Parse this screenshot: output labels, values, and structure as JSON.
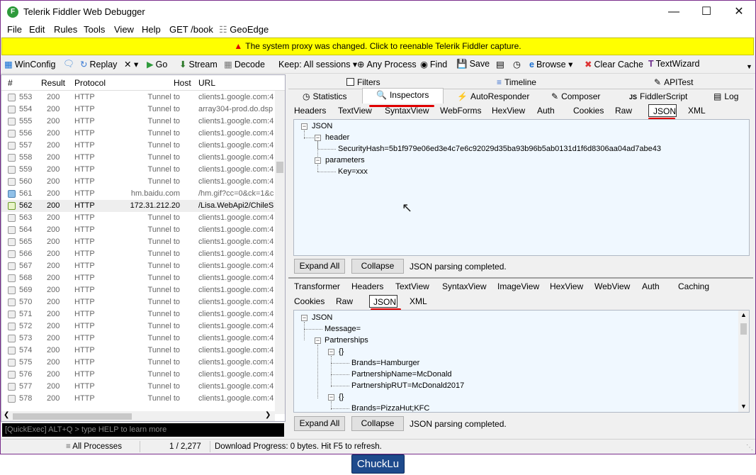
{
  "window": {
    "title": "Telerik Fiddler Web Debugger"
  },
  "menu": [
    "File",
    "Edit",
    "Rules",
    "Tools",
    "View",
    "Help",
    "GET /book",
    "GeoEdge"
  ],
  "notice": "The system proxy was changed. Click to reenable Telerik Fiddler capture.",
  "toolbar": {
    "winconfig": "WinConfig",
    "replay": "Replay",
    "remove": "✕ ▾",
    "go": "Go",
    "stream": "Stream",
    "decode": "Decode",
    "keep": "Keep: All sessions ▾",
    "anyprocess": "Any Process",
    "find": "Find",
    "save": "Save",
    "browse": "Browse",
    "clearcache": "Clear Cache",
    "textwizard": "TextWizard"
  },
  "sessions": {
    "headers": [
      "#",
      "Result",
      "Protocol",
      "Host",
      "URL"
    ],
    "rows": [
      [
        "553",
        "200",
        "HTTP",
        "Tunnel to",
        "clients1.google.com:4"
      ],
      [
        "554",
        "200",
        "HTTP",
        "Tunnel to",
        "array304-prod.do.dsp"
      ],
      [
        "555",
        "200",
        "HTTP",
        "Tunnel to",
        "clients1.google.com:4"
      ],
      [
        "556",
        "200",
        "HTTP",
        "Tunnel to",
        "clients1.google.com:4"
      ],
      [
        "557",
        "200",
        "HTTP",
        "Tunnel to",
        "clients1.google.com:4"
      ],
      [
        "558",
        "200",
        "HTTP",
        "Tunnel to",
        "clients1.google.com:4"
      ],
      [
        "559",
        "200",
        "HTTP",
        "Tunnel to",
        "clients1.google.com:4"
      ],
      [
        "560",
        "200",
        "HTTP",
        "Tunnel to",
        "clients1.google.com:4"
      ],
      [
        "561",
        "200",
        "HTTP",
        "hm.baidu.com",
        "/hm.gif?cc=0&ck=1&c"
      ],
      [
        "562",
        "200",
        "HTTP",
        "172.31.212.20",
        "/Lisa.WebApi2/ChileSe"
      ],
      [
        "563",
        "200",
        "HTTP",
        "Tunnel to",
        "clients1.google.com:4"
      ],
      [
        "564",
        "200",
        "HTTP",
        "Tunnel to",
        "clients1.google.com:4"
      ],
      [
        "565",
        "200",
        "HTTP",
        "Tunnel to",
        "clients1.google.com:4"
      ],
      [
        "566",
        "200",
        "HTTP",
        "Tunnel to",
        "clients1.google.com:4"
      ],
      [
        "567",
        "200",
        "HTTP",
        "Tunnel to",
        "clients1.google.com:4"
      ],
      [
        "568",
        "200",
        "HTTP",
        "Tunnel to",
        "clients1.google.com:4"
      ],
      [
        "569",
        "200",
        "HTTP",
        "Tunnel to",
        "clients1.google.com:4"
      ],
      [
        "570",
        "200",
        "HTTP",
        "Tunnel to",
        "clients1.google.com:4"
      ],
      [
        "571",
        "200",
        "HTTP",
        "Tunnel to",
        "clients1.google.com:4"
      ],
      [
        "572",
        "200",
        "HTTP",
        "Tunnel to",
        "clients1.google.com:4"
      ],
      [
        "573",
        "200",
        "HTTP",
        "Tunnel to",
        "clients1.google.com:4"
      ],
      [
        "574",
        "200",
        "HTTP",
        "Tunnel to",
        "clients1.google.com:4"
      ],
      [
        "575",
        "200",
        "HTTP",
        "Tunnel to",
        "clients1.google.com:4"
      ],
      [
        "576",
        "200",
        "HTTP",
        "Tunnel to",
        "clients1.google.com:4"
      ],
      [
        "577",
        "200",
        "HTTP",
        "Tunnel to",
        "clients1.google.com:4"
      ],
      [
        "578",
        "200",
        "HTTP",
        "Tunnel to",
        "clients1.google.com:4"
      ]
    ]
  },
  "quickexec": "[QuickExec] ALT+Q > type HELP to learn more",
  "status": {
    "processes": "All Processes",
    "count": "1 / 2,277",
    "message": "Download Progress: 0 bytes. Hit F5 to refresh."
  },
  "tabs_row1": {
    "filters": "Filters",
    "timeline": "Timeline",
    "apitest": "APITest"
  },
  "tabs_row2": [
    "Statistics",
    "Inspectors",
    "AutoResponder",
    "Composer",
    "FiddlerScript",
    "Log"
  ],
  "request_tabs": [
    "Headers",
    "TextView",
    "SyntaxView",
    "WebForms",
    "HexView",
    "Auth",
    "Cookies",
    "Raw",
    "JSON",
    "XML"
  ],
  "request_tree": {
    "root": "JSON",
    "header": "header",
    "securityhash": "SecurityHash=5b1f979e06ed3e4c7e6c92029d35ba93b96b5ab0131d1f6d8306aa04ad7abe43",
    "parameters": "parameters",
    "key": "Key=xxx"
  },
  "response_tabs_row1": [
    "Transformer",
    "Headers",
    "TextView",
    "SyntaxView",
    "ImageView",
    "HexView",
    "WebView",
    "Auth",
    "Caching"
  ],
  "response_tabs_row2": [
    "Cookies",
    "Raw",
    "JSON",
    "XML"
  ],
  "response_tree": {
    "root": "JSON",
    "message": "Message=",
    "partnerships": "Partnerships",
    "obj": "{}",
    "brands1": "Brands=Hamburger",
    "pname1": "PartnershipName=McDonald",
    "prut1": "PartnershipRUT=McDonald2017",
    "brands2": "Brands=PizzaHut;KFC"
  },
  "buttons": {
    "expand": "Expand All",
    "collapse": "Collapse",
    "parsed": "JSON parsing completed."
  },
  "taskbar": {
    "label": "ChuckLu"
  },
  "colors": {
    "notice_bg": "#ffff00",
    "underline": "#e00000",
    "pane_bg": "#f0f8ff"
  }
}
